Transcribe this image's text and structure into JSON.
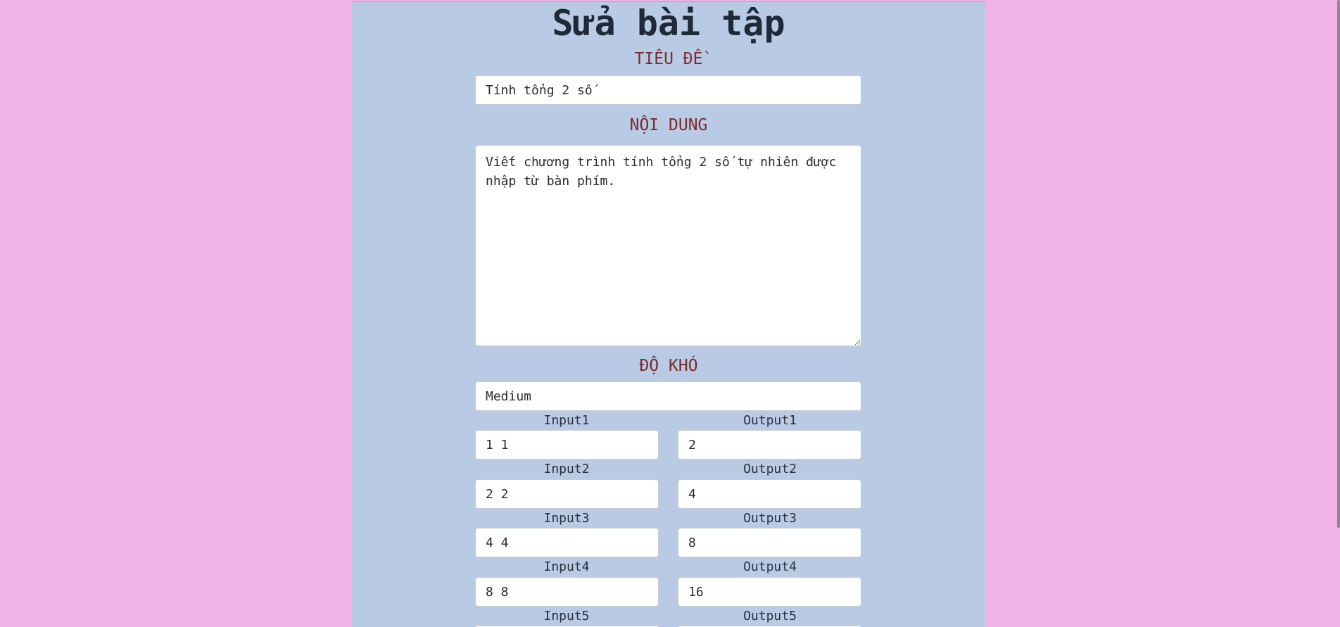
{
  "page": {
    "title": "Sửa bài tập"
  },
  "form": {
    "title_label": "TIÊU ĐỀ",
    "title_value": "Tính tổng 2 số",
    "content_label": "NỘI DUNG",
    "content_value": "Viết chương trình tính tổng 2 số tự nhiên được nhập từ bàn phím.",
    "difficulty_label": "ĐỘ KHÓ",
    "difficulty_value": "Medium",
    "cases": [
      {
        "input_label": "Input1",
        "input_value": "1 1",
        "output_label": "Output1",
        "output_value": "2"
      },
      {
        "input_label": "Input2",
        "input_value": "2 2",
        "output_label": "Output2",
        "output_value": "4"
      },
      {
        "input_label": "Input3",
        "input_value": "4 4",
        "output_label": "Output3",
        "output_value": "8"
      },
      {
        "input_label": "Input4",
        "input_value": "8 8",
        "output_label": "Output4",
        "output_value": "16"
      },
      {
        "input_label": "Input5",
        "input_value": "",
        "output_label": "Output5",
        "output_value": ""
      }
    ]
  },
  "colors": {
    "background": "#f1b3e5",
    "panel": "#b9cae4",
    "section_label": "#7b2a2a",
    "title": "#1f2937"
  }
}
